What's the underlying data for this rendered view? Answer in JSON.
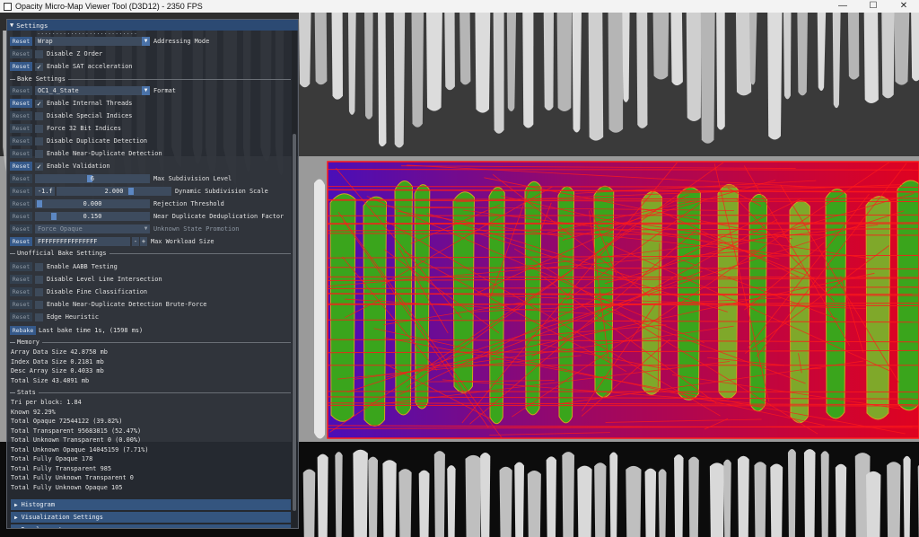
{
  "window": {
    "title": "Opacity Micro-Map Viewer Tool (D3D12) - 2350 FPS",
    "minimize": "—",
    "maximize": "☐",
    "close": "✕"
  },
  "panel": {
    "title": "Settings",
    "cutoff_text": "...........................",
    "reset_label": "Reset",
    "rows_top": [
      {
        "kind": "combo",
        "value": "Wrap",
        "label": "Addressing Mode"
      },
      {
        "kind": "check",
        "checked": false,
        "label": "Disable Z Order"
      },
      {
        "kind": "check",
        "checked": true,
        "label": "Enable SAT acceleration"
      }
    ],
    "bake_section": "Bake Settings",
    "bake_format": {
      "value": "OC1_4_State",
      "label": "Format"
    },
    "bake_checks": [
      {
        "checked": true,
        "label": "Enable Internal Threads"
      },
      {
        "checked": false,
        "label": "Disable Special Indices"
      },
      {
        "checked": false,
        "label": "Force 32 Bit Indices"
      },
      {
        "checked": false,
        "label": "Disable Duplicate Detection"
      },
      {
        "checked": false,
        "label": "Enable Near-Duplicate Detection"
      },
      {
        "checked": true,
        "label": "Enable Validation"
      }
    ],
    "max_subdiv": {
      "value": "6",
      "label": "Max Subdivision Level"
    },
    "dyn_subdiv": {
      "prefix": "-1.f",
      "value": "2.000",
      "label": "Dynamic Subdivision Scale"
    },
    "rejection": {
      "value": "0.000",
      "label": "Rejection Threshold"
    },
    "near_dup": {
      "value": "0.150",
      "label": "Near Duplicate Deduplication Factor"
    },
    "unknown_state": {
      "value": "Force Opaque",
      "label": "Unknown State Promotion"
    },
    "max_workload": {
      "value": "FFFFFFFFFFFFFFFF",
      "minus": "-",
      "plus": "+",
      "label": "Max Workload Size"
    },
    "unofficial_section": "Unofficial Bake Settings",
    "unofficial_checks": [
      {
        "checked": false,
        "label": "Enable AABB Testing"
      },
      {
        "checked": false,
        "label": "Disable Level Line Intersection"
      },
      {
        "checked": false,
        "label": "Disable Fine Classification"
      },
      {
        "checked": false,
        "label": "Enable Near-Duplicate Detection Brute-Force"
      },
      {
        "checked": false,
        "label": "Edge Heuristic"
      }
    ],
    "rebake": {
      "button": "Rebake",
      "text": "Last bake time 1s, (1598 ms)"
    },
    "memory_section": "Memory",
    "memory_lines": [
      "Array Data Size 42.8758 mb",
      "Index Data Size 0.2181 mb",
      "Desc Array Size 0.4033 mb",
      "Total Size 43.4891 mb"
    ],
    "stats_section": "Stats",
    "stats_lines": [
      "Tri per block: 1.84",
      "Known 92.29%",
      "Total Opaque 72544122 (39.82%)",
      "Total Transparent 95683815 (52.47%)",
      "Total Unknown Transparent 0 (0.00%)",
      "Total Unknown Opaque 14045159 (7.71%)",
      "Total Fully Opaque 178",
      "Total Fully Transparent 985",
      "Total Fully Unknown Transparent 0",
      "Total Fully Unknown Opaque 105"
    ],
    "collapsed": [
      "Histogram",
      "Visualization Settings",
      "Development"
    ]
  },
  "colors": {
    "accent": "#35598a",
    "wireframe_red": "#ff1a1a",
    "wireframe_blue": "#2a10d8",
    "opaque_green": "#3aa51c"
  }
}
